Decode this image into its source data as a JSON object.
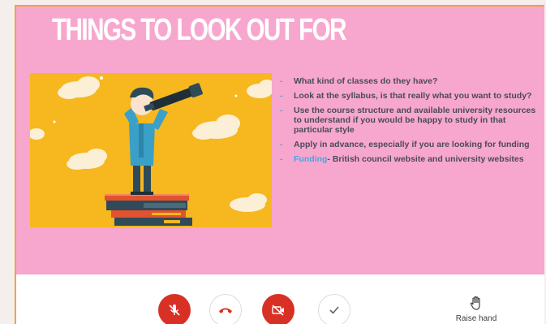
{
  "slide": {
    "title": "THINGS TO LOOK OUT FOR",
    "bullets": [
      {
        "text": "What kind of classes do they have?"
      },
      {
        "text": "Look at the syllabus, is that really what you want to study?"
      },
      {
        "text": "Use the course structure and available university resources to understand if you would be happy to study in that particular style"
      },
      {
        "text": "Apply in advance, especially if you are looking for funding"
      },
      {
        "link": "Funding",
        "text": "- British council website and university websites"
      }
    ],
    "bullet_marker": "-",
    "colors": {
      "background": "#f7a7ce",
      "illustration": "#f6b71f",
      "accent": "#4aa3e8"
    }
  },
  "controls": {
    "mic": {
      "icon": "mic-off-icon",
      "state": "muted"
    },
    "hangup": {
      "icon": "hang-up-icon"
    },
    "camera": {
      "icon": "camera-off-icon",
      "state": "off"
    },
    "confirm": {
      "icon": "checkmark-icon"
    },
    "raise_hand": {
      "label": "Raise hand",
      "icon": "hand-icon"
    }
  }
}
